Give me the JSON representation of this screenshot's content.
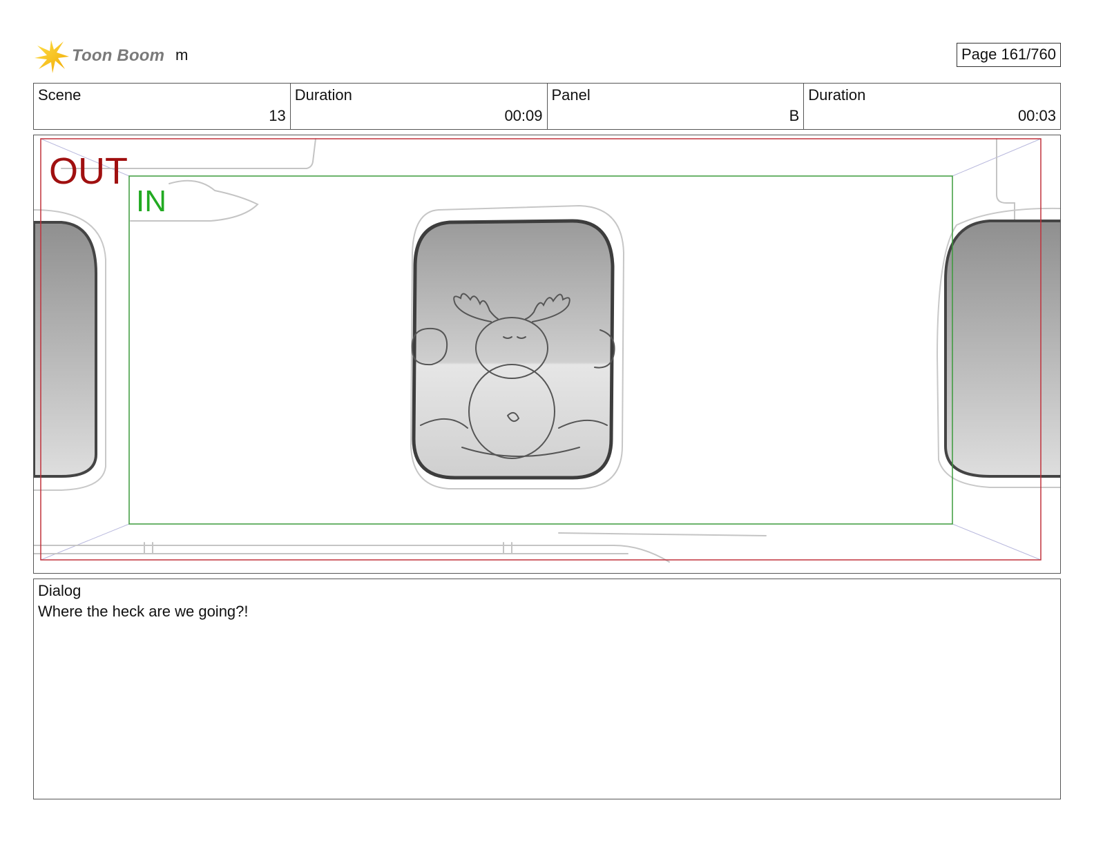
{
  "header": {
    "logo_text": "Toon Boom",
    "project_name": "m",
    "page_label": "Page 161/760"
  },
  "info": {
    "scene_label": "Scene",
    "scene_value": "13",
    "scene_duration_label": "Duration",
    "scene_duration_value": "00:09",
    "panel_label": "Panel",
    "panel_value": "B",
    "panel_duration_label": "Duration",
    "panel_duration_value": "00:03"
  },
  "frame": {
    "out_label": "OUT",
    "in_label": "IN",
    "out_color": "#a01010",
    "in_color": "#22aa22"
  },
  "dialog": {
    "label": "Dialog",
    "text": "Where the heck are we going?!"
  },
  "colors": {
    "logo_star": "#f5c400",
    "border": "#555555"
  }
}
